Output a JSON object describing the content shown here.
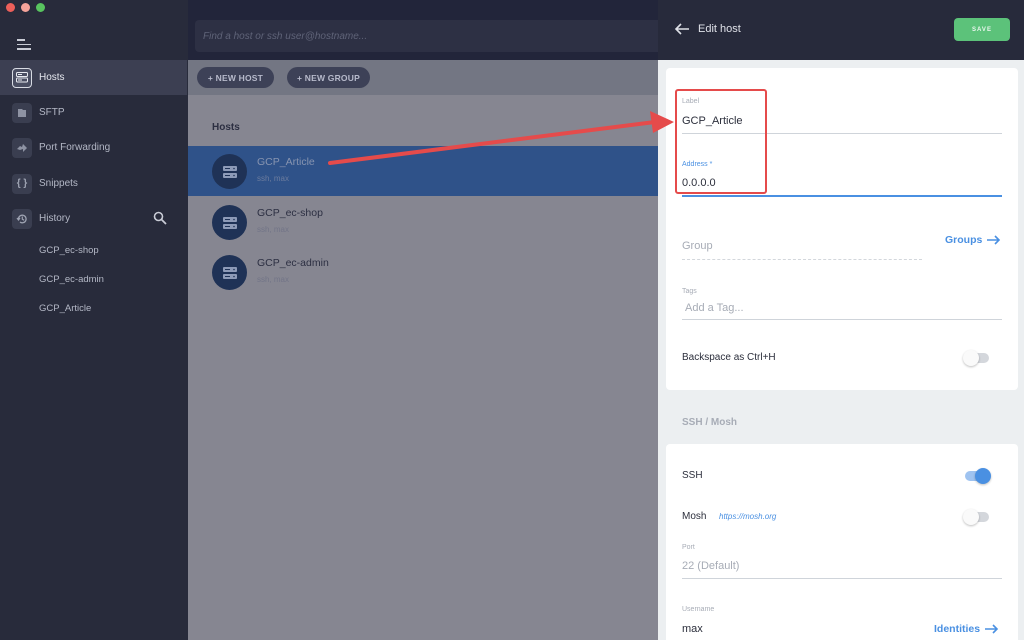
{
  "window": {
    "traffic_lights": [
      {
        "name": "close",
        "color": "#ec5f5a"
      },
      {
        "name": "minimize",
        "color": "#f5a39a"
      },
      {
        "name": "zoom",
        "color": "#58c45f"
      }
    ]
  },
  "sidebar": {
    "menu_icon": "hamburger-icon",
    "items": [
      {
        "label": "Hosts",
        "icon": "server-icon",
        "active": true
      },
      {
        "label": "SFTP",
        "icon": "folder-icon",
        "active": false
      },
      {
        "label": "Port Forwarding",
        "icon": "port-forward-icon",
        "active": false
      },
      {
        "label": "Snippets",
        "icon": "braces-icon",
        "active": false
      },
      {
        "label": "History",
        "icon": "history-icon",
        "active": false
      }
    ],
    "history_search_icon": "search-icon",
    "history": [
      "GCP_ec-shop",
      "GCP_ec-admin",
      "GCP_Article"
    ]
  },
  "search": {
    "placeholder": "Find a host or ssh user@hostname...",
    "value": ""
  },
  "toolbar": {
    "new_host": "+ NEW HOST",
    "new_group": "+ NEW GROUP"
  },
  "hosts": {
    "section_title": "Hosts",
    "items": [
      {
        "name": "GCP_Article",
        "sub": "ssh, max",
        "selected": true
      },
      {
        "name": "GCP_ec-shop",
        "sub": "ssh, max",
        "selected": false
      },
      {
        "name": "GCP_ec-admin",
        "sub": "ssh, max",
        "selected": false
      }
    ]
  },
  "edit_panel": {
    "title": "Edit host",
    "save_label": "SAVE",
    "colors": {
      "accent": "#4a90e2",
      "save": "#5cc27a",
      "annotation": "#e54b4b"
    },
    "label_field": {
      "label": "Label",
      "value": "GCP_Article"
    },
    "address_field": {
      "label": "Address *",
      "value": "0.0.0.0"
    },
    "group_field": {
      "placeholder": "Group",
      "value": ""
    },
    "groups_link": "Groups",
    "tags_field": {
      "label": "Tags",
      "placeholder": "Add a Tag...",
      "value": ""
    },
    "backspace_toggle": {
      "label": "Backspace as Ctrl+H",
      "on": false
    },
    "ssh_mosh_heading": "SSH / Mosh",
    "ssh_toggle": {
      "label": "SSH",
      "on": true
    },
    "mosh_toggle": {
      "label": "Mosh",
      "link": "https://mosh.org",
      "on": false
    },
    "port_field": {
      "label": "Port",
      "placeholder": "22 (Default)",
      "value": ""
    },
    "username_field": {
      "label": "Username",
      "value": "max"
    },
    "identities_link": "Identities"
  }
}
